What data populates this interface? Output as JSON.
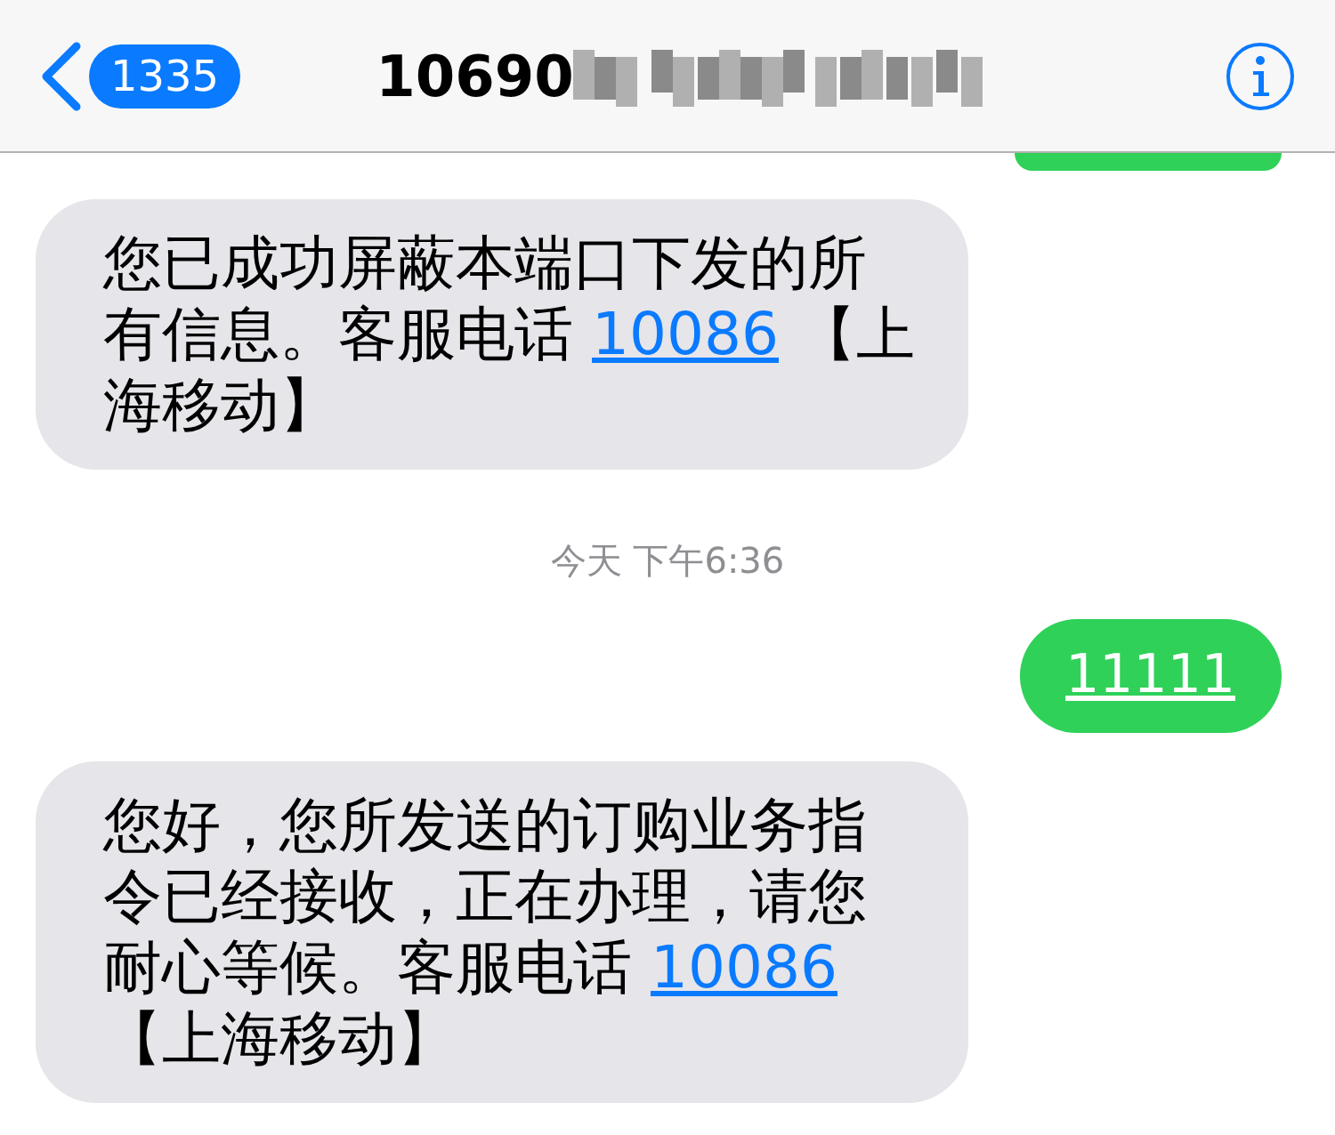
{
  "header": {
    "back_count": "1335",
    "title": "10690"
  },
  "messages": [
    {
      "kind": "cut_off_outgoing"
    },
    {
      "kind": "incoming",
      "segments": [
        {
          "kind": "plain",
          "text": "您已成功屏蔽本端口下发的所有信息。客服电话 "
        },
        {
          "kind": "link",
          "text": "10086"
        },
        {
          "kind": "plain",
          "text": " 【上海移动】"
        }
      ]
    },
    {
      "kind": "timestamp",
      "text": "今天 下午6:36"
    },
    {
      "kind": "outgoing",
      "segments": [
        {
          "kind": "link",
          "text": "11111"
        }
      ]
    },
    {
      "kind": "incoming",
      "segments": [
        {
          "kind": "plain",
          "text": "您好，您所发送的订购业务指令已经接收，正在办理，请您耐心等候。客服电话 "
        },
        {
          "kind": "link",
          "text": "10086"
        },
        {
          "kind": "plain",
          "text": " 【上海移动】"
        }
      ]
    }
  ]
}
